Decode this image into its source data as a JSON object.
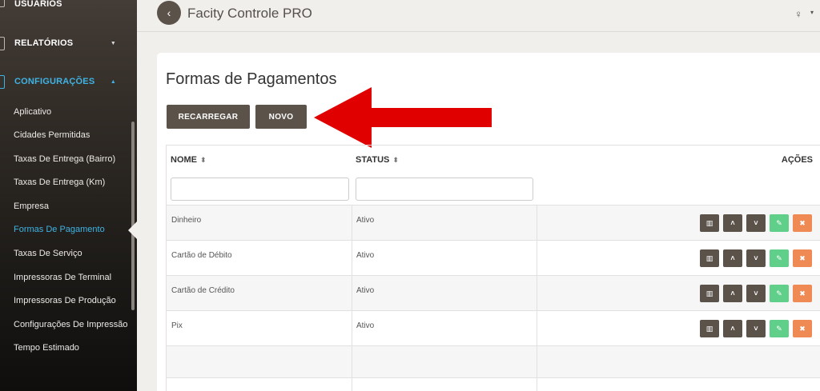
{
  "sidebar": {
    "usuarios": "USUÁRIOS",
    "relatorios": "RELATÓRIOS",
    "configuracoes": "CONFIGURAÇÕES",
    "items": [
      {
        "label": "Aplicativo"
      },
      {
        "label": "Cidades Permitidas"
      },
      {
        "label": "Taxas De Entrega (Bairro)"
      },
      {
        "label": "Taxas De Entrega (Km)"
      },
      {
        "label": "Empresa"
      },
      {
        "label": "Formas De Pagamento"
      },
      {
        "label": "Taxas De Serviço"
      },
      {
        "label": "Impressoras De Terminal"
      },
      {
        "label": "Impressoras De Produção"
      },
      {
        "label": "Configurações De Impressão"
      },
      {
        "label": "Tempo Estimado"
      }
    ]
  },
  "header": {
    "back": "‹",
    "title": "Facity Controle PRO",
    "user_icon": "♀",
    "user_caret": "▾"
  },
  "page": {
    "title": "Formas de Pagamentos",
    "reload_label": "RECARREGAR",
    "new_label": "NOVO"
  },
  "table": {
    "headers": {
      "name": "NOME",
      "status": "STATUS",
      "actions": "AÇÕES"
    },
    "sort_glyph": "⬍",
    "rows": [
      {
        "name": "Dinheiro",
        "status": "Ativo"
      },
      {
        "name": "Cartão de Débito",
        "status": "Ativo"
      },
      {
        "name": "Cartão de Crédito",
        "status": "Ativo"
      },
      {
        "name": "Pix",
        "status": "Ativo"
      }
    ],
    "action_icons": {
      "columns": "▥",
      "up": "˄",
      "down": "˅",
      "edit": "✎",
      "delete": "✖"
    }
  },
  "colors": {
    "accent": "#3fb3e3",
    "button": "#5b524a",
    "edit": "#5fcf8a",
    "delete": "#f08a55",
    "arrow": "#e00000"
  }
}
